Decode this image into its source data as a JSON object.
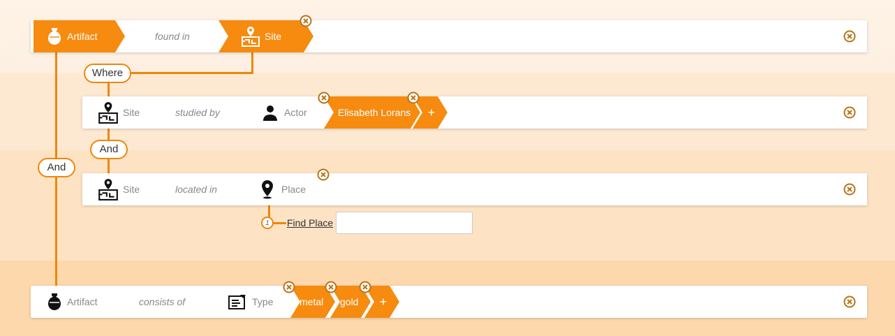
{
  "colors": {
    "accent": "#f68b0f",
    "line": "#f0860a"
  },
  "row1": {
    "subject": {
      "label": "Artifact",
      "icon": "vase-icon"
    },
    "predicate": "found in",
    "object": {
      "label": "Site",
      "icon": "site-map-icon"
    }
  },
  "connector_where": "Where",
  "row2": {
    "subject": {
      "label": "Site",
      "icon": "site-map-icon"
    },
    "predicate": "studied by",
    "object": {
      "label": "Actor",
      "icon": "person-icon"
    },
    "values": [
      "Elisabeth Lorans"
    ],
    "add": "+"
  },
  "connector_and_inner": "And",
  "connector_and_outer": "And",
  "row3": {
    "subject": {
      "label": "Site",
      "icon": "site-map-icon"
    },
    "predicate": "located in",
    "object": {
      "label": "Place",
      "icon": "map-pin-icon"
    },
    "find": {
      "number": "1",
      "link": "Find Place",
      "input_value": ""
    }
  },
  "row4": {
    "subject": {
      "label": "Artifact",
      "icon": "vase-icon"
    },
    "predicate": "consists of",
    "object": {
      "label": "Type",
      "icon": "type-list-icon"
    },
    "values": [
      "metal",
      "gold"
    ],
    "add": "+"
  }
}
